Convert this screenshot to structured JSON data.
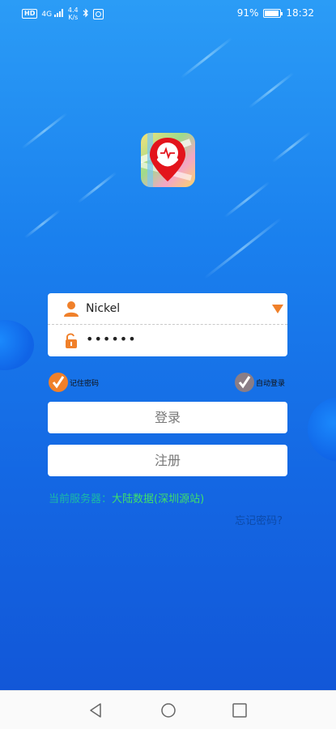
{
  "status_bar": {
    "hd": "HD",
    "signal": "4G",
    "speed_value": "4.4",
    "speed_unit": "K/s",
    "battery": "91%",
    "battery_level": 0.91,
    "time": "18:32"
  },
  "login_form": {
    "username": "Nickel",
    "password_masked": "••••••"
  },
  "options": {
    "remember_label": "记住密码",
    "auto_login_label": "自动登录"
  },
  "buttons": {
    "login_label": "登录",
    "register_label": "注册"
  },
  "server": {
    "label": "当前服务器：",
    "value": "大陆数据(深圳源站)"
  },
  "forgot_label": "忘记密码?",
  "colors": {
    "accent_orange": "#f0802a",
    "server_label": "#1bb9a6",
    "server_value": "#3fdf6a",
    "forgot": "#0d4aa8"
  },
  "icons": [
    "user-icon",
    "lock-icon",
    "dropdown-arrow-icon",
    "check-icon",
    "app-logo",
    "back-icon",
    "home-icon",
    "recent-apps-icon",
    "bluetooth-icon"
  ]
}
